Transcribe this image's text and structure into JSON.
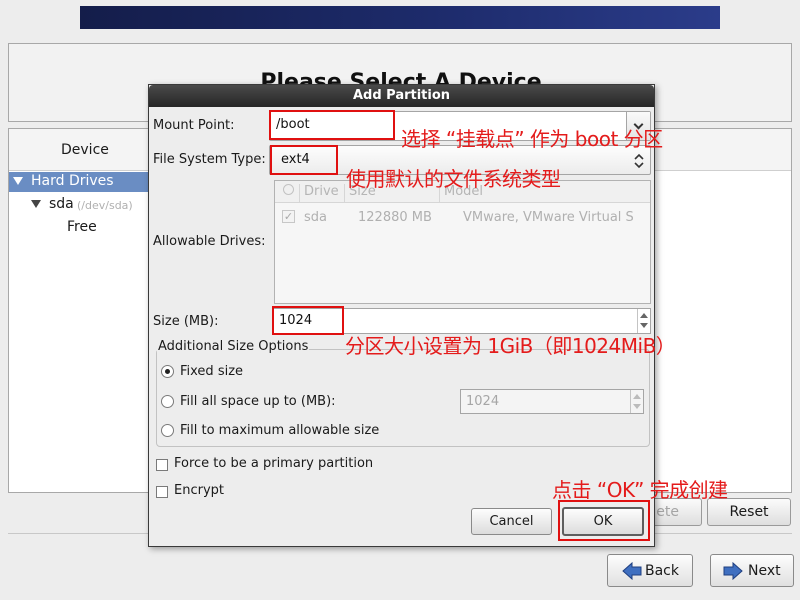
{
  "page": {
    "heading": "Please Select A Device"
  },
  "device_panel": {
    "column_header": "Device",
    "tree": {
      "hard_drives": "Hard Drives",
      "sda_name": "sda",
      "sda_path": "(/dev/sda)",
      "free": "Free"
    }
  },
  "background_buttons": {
    "delete_partial": "ete",
    "reset": "Reset",
    "back": "Back",
    "next": "Next"
  },
  "dialog": {
    "title": "Add Partition",
    "mount_point_label": "Mount Point:",
    "mount_point_value": "/boot",
    "fs_type_label": "File System Type:",
    "fs_type_value": "ext4",
    "allowable_drives_label": "Allowable Drives:",
    "drives_columns": [
      "Drive",
      "Size",
      "Model"
    ],
    "drives_rows": [
      {
        "checked": true,
        "drive": "sda",
        "size": "122880 MB",
        "model": "VMware, VMware Virtual S"
      }
    ],
    "size_label": "Size (MB):",
    "size_value": "1024",
    "additional_size_legend": "Additional Size Options",
    "fixed_size": "Fixed size",
    "fill_up_to": "Fill all space up to (MB):",
    "fill_up_to_value": "1024",
    "fill_max": "Fill to maximum allowable size",
    "selected_size_option": "fixed",
    "primary_partition": "Force to be a primary partition",
    "encrypt": "Encrypt",
    "cancel": "Cancel",
    "ok": "OK"
  },
  "annotations": {
    "mount_note": "选择 “挂载点” 作为 boot 分区",
    "fs_note": "使用默认的文件系统类型",
    "size_note": "分区大小设置为 1GiB（即1024MiB）",
    "ok_note": "点击 “OK” 完成创建"
  },
  "colors": {
    "annotation_red": "#e41b1b",
    "selection_blue": "#6a8dc3",
    "title_bar": "#2f2f2f"
  }
}
